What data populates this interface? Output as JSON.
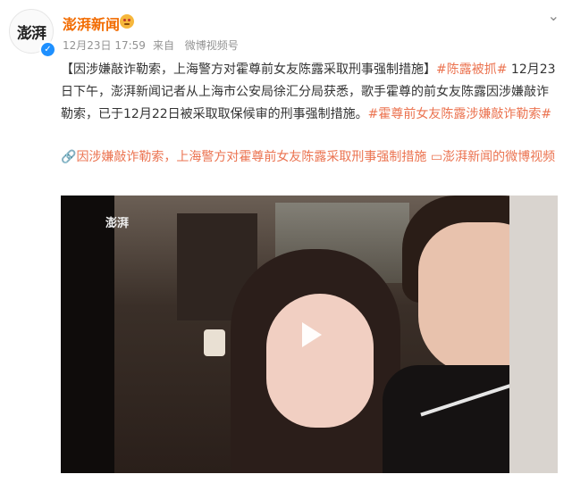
{
  "header": {
    "avatar_text": "澎湃",
    "author": "澎湃新闻",
    "date": "12月23日 17:59",
    "source_prefix": "来自",
    "source": "微博视频号",
    "verified_mark": "✓",
    "more_glyph": "⌄"
  },
  "post": {
    "headline": "【因涉嫌敲诈勒索，上海警方对霍尊前女友陈露采取刑事强制措施】",
    "tag1": "#陈露被抓#",
    "body": " 12月23日下午，澎湃新闻记者从上海市公安局徐汇分局获悉，歌手霍尊的前女友陈露因涉嫌敲诈勒索，已于12月22日被采取取保候审的刑事强制措施。",
    "tag2": "#霍尊前女友陈露涉嫌敲诈勒索#"
  },
  "links": {
    "link1_icon": "🔗",
    "link1": "因涉嫌敲诈勒索，上海警方对霍尊前女友陈露采取刑事强制措施",
    "link2_icon": "▭",
    "link2": "澎湃新闻的微博视频"
  },
  "video": {
    "watermark": "澎湃",
    "state": "paused"
  },
  "colors": {
    "author": "#f26b00",
    "link": "#eb7350",
    "meta": "#939393"
  }
}
